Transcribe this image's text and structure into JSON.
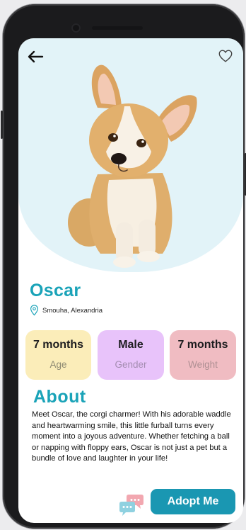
{
  "pet": {
    "name": "Oscar",
    "location": "Smouha, Alexandria",
    "image_icon": "corgi-illustration"
  },
  "stats": [
    {
      "value": "7 months",
      "label": "Age"
    },
    {
      "value": "Male",
      "label": "Gender"
    },
    {
      "value": "7 months",
      "label": "Weight"
    }
  ],
  "about": {
    "title": "About",
    "text": "Meet Oscar, the corgi charmer!  With his adorable waddle and heartwarming smile, this little furball turns every moment into a joyous adventure. Whether fetching a ball or napping with floppy ears, Oscar is not just a pet but a bundle of love and laughter in your life!"
  },
  "actions": {
    "adopt_label": "Adopt Me",
    "back_icon": "back-arrow-icon",
    "favorite_icon": "heart-icon",
    "chat_icon": "chat-bubbles-icon"
  },
  "colors": {
    "accent": "#1aa3b8",
    "button": "#1a97b2",
    "hero_bg": "#e2f3f8",
    "age_card": "#fbedb9",
    "gender_card": "#e8c3fa",
    "weight_card": "#f0bcc2"
  }
}
